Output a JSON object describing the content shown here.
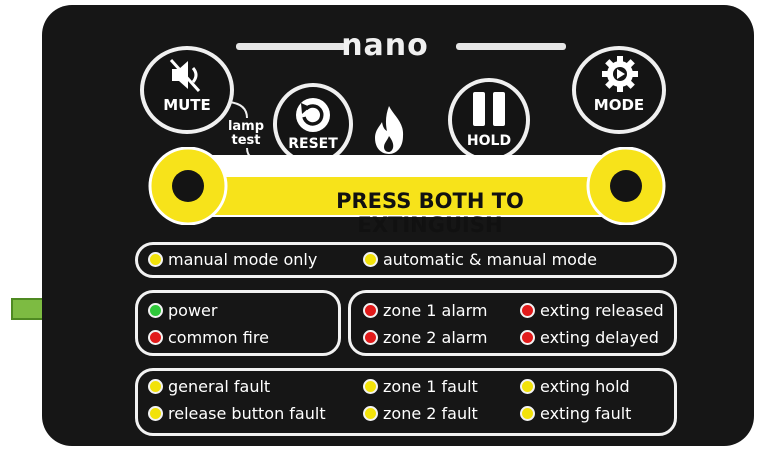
{
  "panel": {
    "brand": "nano",
    "buttons": {
      "mute_label": "MUTE",
      "reset_label": "RESET",
      "hold_label": "HOLD",
      "mode_label": "MODE"
    },
    "lamp_test_line1": "lamp",
    "lamp_test_line2": "test",
    "extinguish_label": "PRESS BOTH TO EXTINGUISH"
  },
  "mode_row": [
    {
      "label": "manual mode only",
      "color": "#f2e20a"
    },
    {
      "label": "automatic & manual mode",
      "color": "#f2e20a"
    }
  ],
  "status_left": [
    {
      "label": "power",
      "color": "#2fc83a"
    },
    {
      "label": "common fire",
      "color": "#e11a1a"
    }
  ],
  "status_right": [
    {
      "label": "zone 1 alarm",
      "color": "#e11a1a"
    },
    {
      "label": "exting released",
      "color": "#e11a1a"
    },
    {
      "label": "zone 2 alarm",
      "color": "#e11a1a"
    },
    {
      "label": "exting delayed",
      "color": "#e11a1a"
    }
  ],
  "faults": [
    {
      "label": "general fault",
      "color": "#f2e20a"
    },
    {
      "label": "zone 1 fault",
      "color": "#f2e20a"
    },
    {
      "label": "exting hold",
      "color": "#f2e20a"
    },
    {
      "label": "release button fault",
      "color": "#f2e20a"
    },
    {
      "label": "zone 2 fault",
      "color": "#f2e20a"
    },
    {
      "label": "exting fault",
      "color": "#f2e20a"
    }
  ],
  "colors": {
    "panel": "#161616",
    "accent_yellow": "#f7e31a",
    "arrow_green": "#7dbb42"
  }
}
